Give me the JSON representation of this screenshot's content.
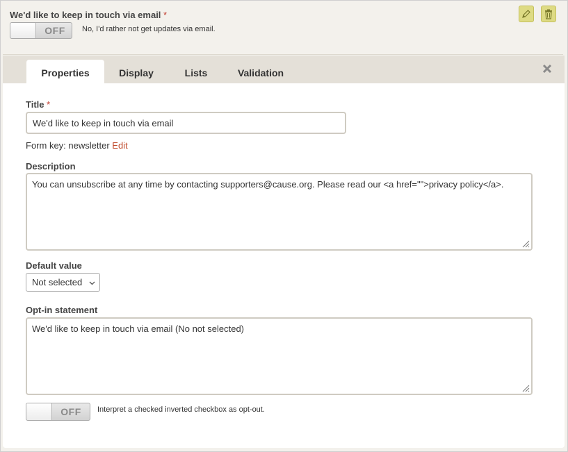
{
  "preview": {
    "title": "We'd like to keep in touch via email",
    "required_mark": "*",
    "toggle_state": "OFF",
    "toggle_note": "No, I'd rather not get updates via email."
  },
  "icons": {
    "edit": "pencil-icon",
    "delete": "trash-icon",
    "close": "close-icon"
  },
  "tabs": [
    {
      "label": "Properties",
      "active": true
    },
    {
      "label": "Display",
      "active": false
    },
    {
      "label": "Lists",
      "active": false
    },
    {
      "label": "Validation",
      "active": false
    }
  ],
  "form": {
    "title_label": "Title",
    "title_required": "*",
    "title_value": "We'd like to keep in touch via email",
    "form_key_prefix": "Form key: newsletter",
    "form_key_edit": "Edit",
    "description_label": "Description",
    "description_value": "You can unsubscribe at any time by contacting supporters@cause.org. Please read our <a href=\"\">privacy policy</a>.",
    "default_label": "Default value",
    "default_value": "Not selected",
    "optin_label": "Opt-in statement",
    "optin_value": "We'd like to keep in touch via email (No not selected)",
    "invert_toggle_state": "OFF",
    "invert_note": "Interpret a checked inverted checkbox as opt-out."
  },
  "colors": {
    "accent_button": "#dedb84",
    "required": "#c0392b",
    "link": "#c0492b",
    "header_bg": "#f3f1ec",
    "tabs_bg": "#e4e0d8"
  }
}
